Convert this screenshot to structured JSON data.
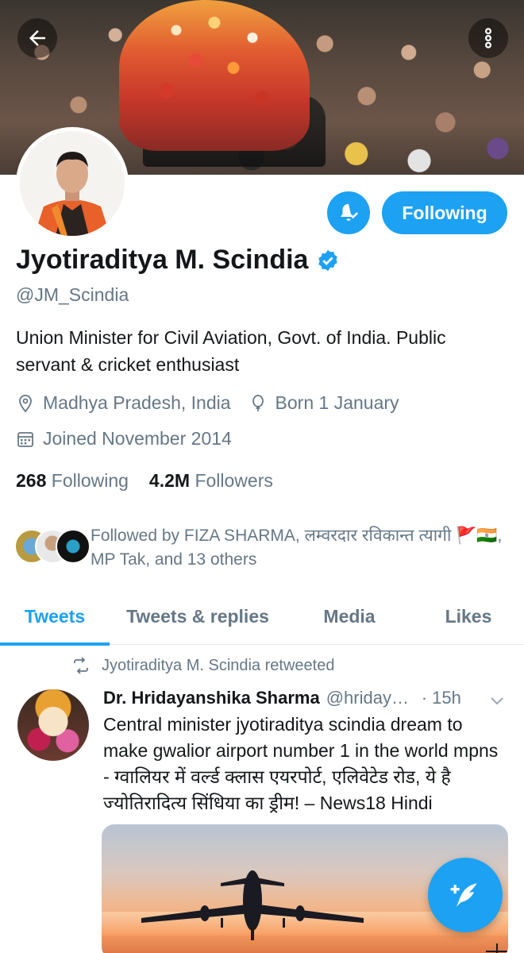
{
  "header": {
    "back_icon": "arrow-left-icon",
    "more_icon": "more-vertical-icon"
  },
  "profile": {
    "name": "Jyotiraditya M. Scindia",
    "verified": true,
    "handle": "@JM_Scindia",
    "bio": "Union Minister for Civil Aviation, Govt. of India. Public servant & cricket enthusiast",
    "location": "Madhya Pradesh, India",
    "birthday": "Born 1 January",
    "joined": "Joined November 2014",
    "following_count": "268",
    "following_label": "Following",
    "followers_count": "4.2M",
    "followers_label": "Followers",
    "followed_by": "Followed by FIZA SHARMA, लम्वरदार रविकान्त त्यागी 🚩🇮🇳, MP Tak, and 13 others"
  },
  "actions": {
    "notifications_icon": "bell-check-icon",
    "following_button": "Following"
  },
  "tabs": [
    {
      "label": "Tweets",
      "active": true
    },
    {
      "label": "Tweets & replies",
      "active": false
    },
    {
      "label": "Media",
      "active": false
    },
    {
      "label": "Likes",
      "active": false
    }
  ],
  "tweet": {
    "retweet_label": "Jyotiraditya M. Scindia retweeted",
    "author_name": "Dr. Hridayanshika Sharma",
    "author_handle": "@hridayanshika",
    "time": "· 15h",
    "text": "Central minister jyotiraditya scindia dream to make gwalior airport number 1 in the world mpns - ग्वालियर में वर्ल्ड क्लास एयरपोर्ट, एलिवेटेड रोड, ये है ज्योतिरादित्य सिंधिया का ड्रीम! – News18 Hindi"
  },
  "colors": {
    "accent": "#1da1f2",
    "text_primary": "#14171a",
    "text_secondary": "#657786"
  },
  "fab": {
    "icon": "compose-tweet-icon"
  }
}
